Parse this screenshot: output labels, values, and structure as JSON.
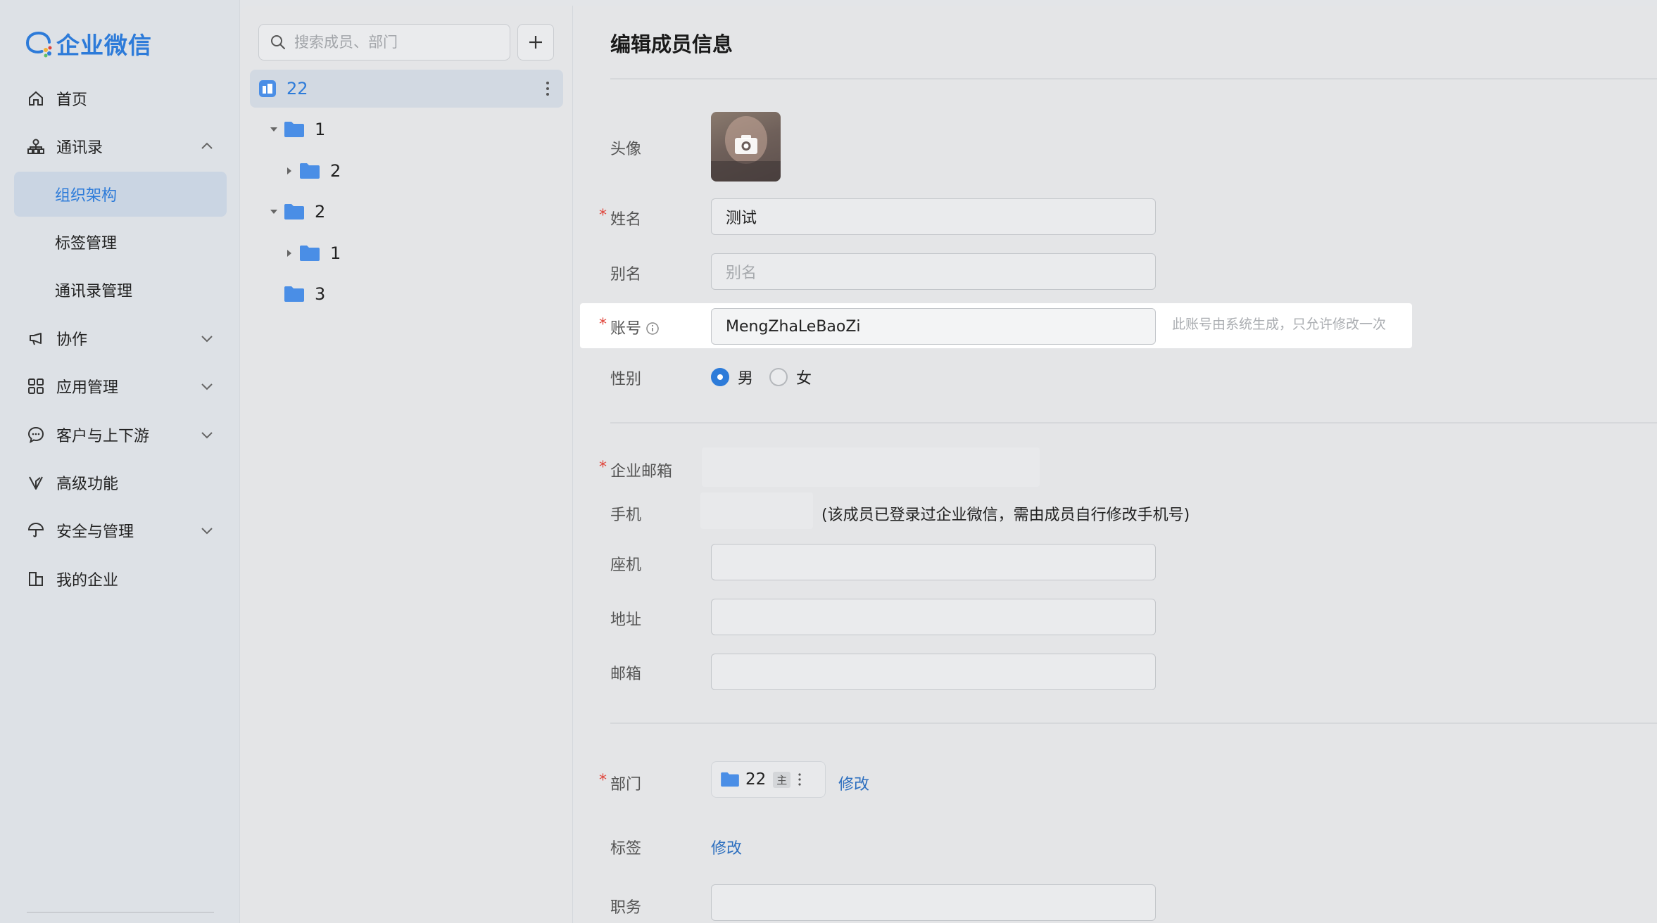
{
  "app": {
    "logo_text": "企业微信"
  },
  "sidebar": {
    "items": [
      {
        "label": "首页"
      },
      {
        "label": "通讯录"
      },
      {
        "label": "组织架构"
      },
      {
        "label": "标签管理"
      },
      {
        "label": "通讯录管理"
      },
      {
        "label": "协作"
      },
      {
        "label": "应用管理"
      },
      {
        "label": "客户与上下游"
      },
      {
        "label": "高级功能"
      },
      {
        "label": "安全与管理"
      },
      {
        "label": "我的企业"
      }
    ]
  },
  "tree": {
    "search_placeholder": "搜索成员、部门",
    "root": {
      "label": "22"
    },
    "nodes": [
      {
        "label": "1"
      },
      {
        "label": "2"
      },
      {
        "label": "2"
      },
      {
        "label": "1"
      },
      {
        "label": "3"
      }
    ]
  },
  "form": {
    "title": "编辑成员信息",
    "avatar_label": "头像",
    "name_label": "姓名",
    "name_value": "测试",
    "alias_label": "别名",
    "alias_placeholder": "别名",
    "account_label": "账号",
    "account_value": "MengZhaLeBaoZi",
    "account_hint": "此账号由系统生成，只允许修改一次",
    "gender_label": "性别",
    "gender_male": "男",
    "gender_female": "女",
    "email_label": "企业邮箱",
    "phone_label": "手机",
    "phone_note": "(该成员已登录过企业微信，需由成员自行修改手机号)",
    "landline_label": "座机",
    "address_label": "地址",
    "mailbox_label": "邮箱",
    "dept_label": "部门",
    "dept_value": "22",
    "dept_main_tag": "主",
    "dept_edit": "修改",
    "tag_label": "标签",
    "tag_edit": "修改",
    "position_label": "职务",
    "required_mark": "*"
  },
  "colors": {
    "accent": "#2d7bd9",
    "required": "#e0443a"
  }
}
